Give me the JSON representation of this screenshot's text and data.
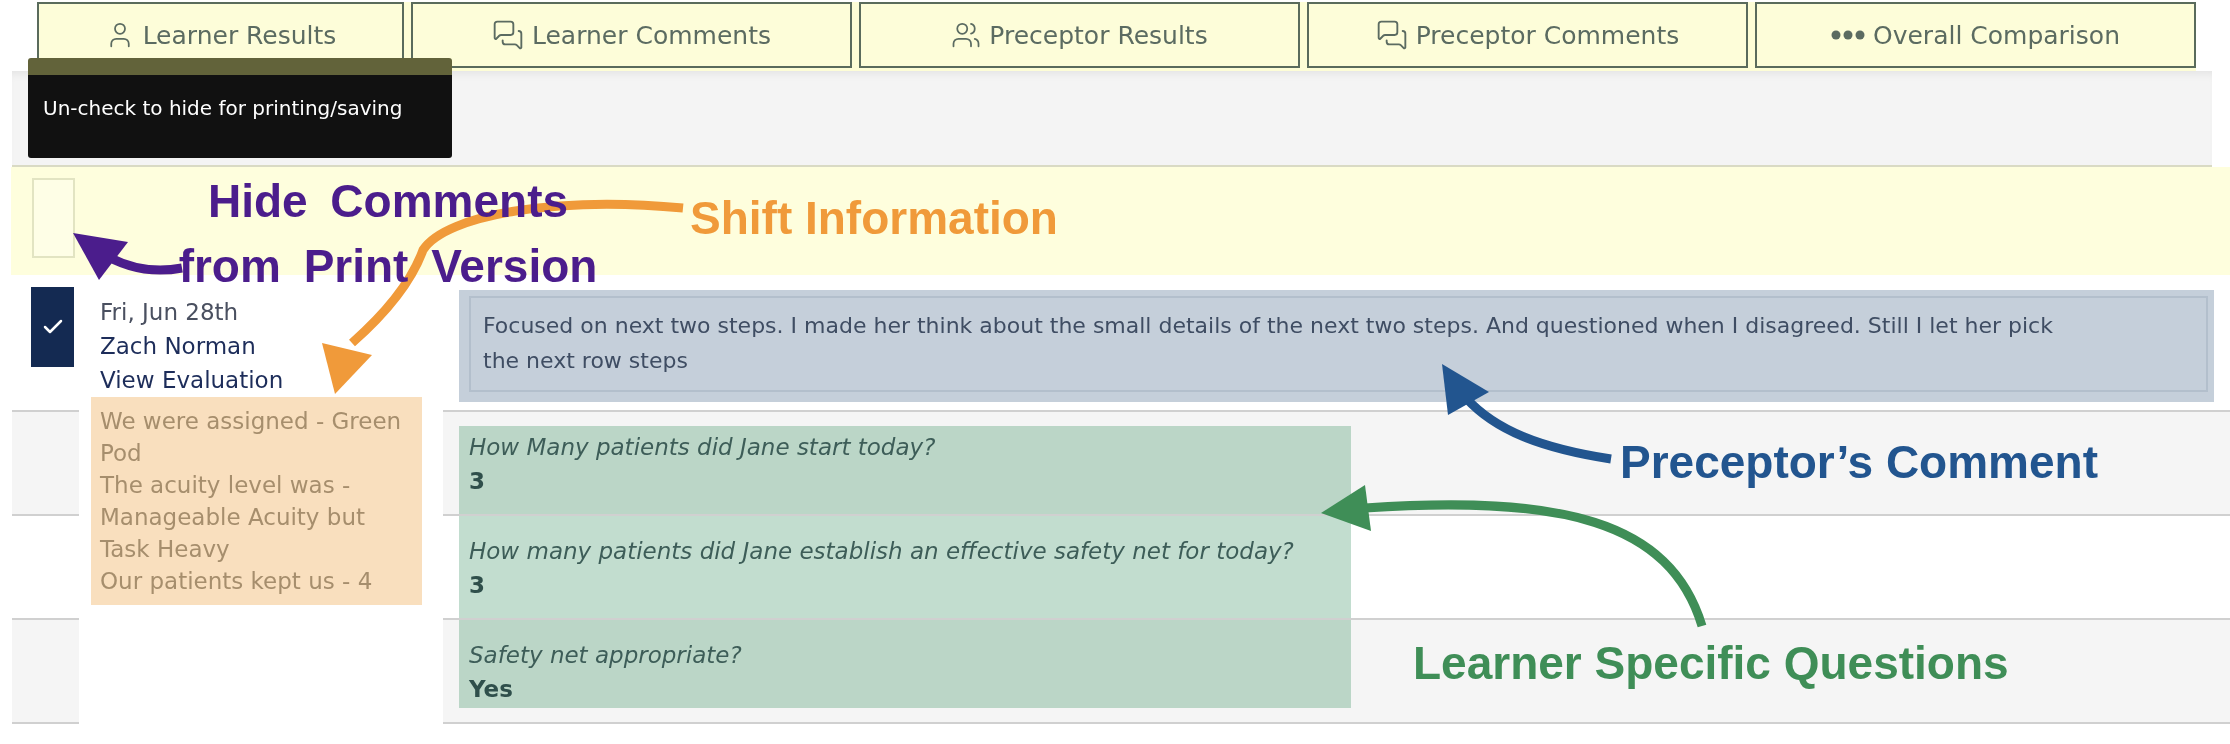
{
  "tabs": [
    {
      "label": "Learner Results",
      "selected": false
    },
    {
      "label": "Learner Comments",
      "selected": false
    },
    {
      "label": "Preceptor Results",
      "selected": false
    },
    {
      "label": "Preceptor Comments",
      "selected": false
    },
    {
      "label": "Overall Comparison",
      "selected": false
    }
  ],
  "tooltip": {
    "text": "Un-check to hide for printing/saving"
  },
  "print_toggle": {
    "checked": false
  },
  "entry": {
    "checked": true,
    "date": "Fri, Jun 28th",
    "preceptor": "Zach Norman",
    "link": "View Evaluation",
    "shift_information": [
      "We were assigned - Green Pod",
      "The acuity level was - Manageable Acuity but Task Heavy",
      "Our patients kept us - 4"
    ],
    "preceptor_comment": "Focused on next two steps. I made her think about the small details of the next two steps. And questioned when I disagreed. Still I let her pick the next row steps",
    "questions": [
      {
        "question": "How Many patients did Jane start today?",
        "answer": "3"
      },
      {
        "question": "How many patients did Jane establish an effective safety net for today?",
        "answer": "3"
      },
      {
        "question": "Safety net appropriate?",
        "answer": "Yes"
      }
    ]
  },
  "annotations": [
    {
      "lines": [
        "Hide Comments",
        "from Print Version"
      ],
      "color": "#4b1d8c"
    },
    {
      "lines": [
        "Shift Information"
      ],
      "color": "#f09a3a"
    },
    {
      "lines": [
        "Preceptor’s Comment"
      ],
      "color": "#22558f"
    },
    {
      "lines": [
        "Learner Specific Questions"
      ],
      "color": "#3f8e57"
    }
  ]
}
